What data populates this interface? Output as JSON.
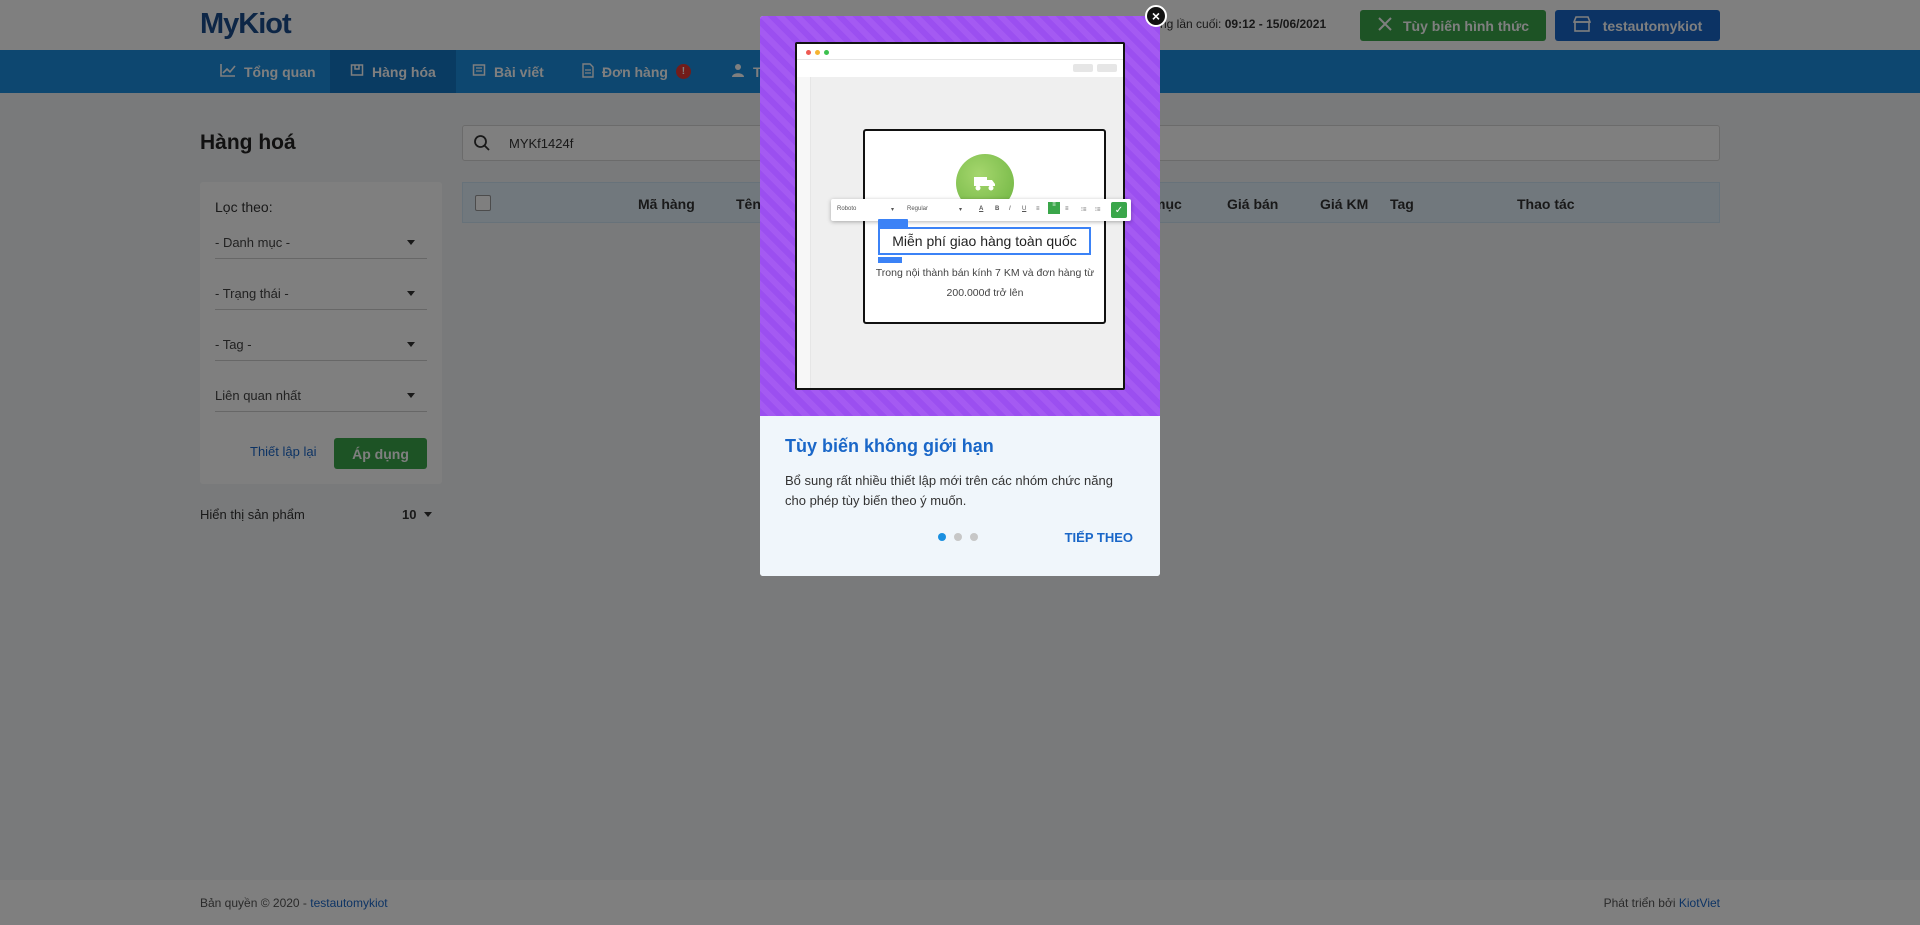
{
  "header": {
    "logo": "MyKiot",
    "last_login_prefix": "ng lần cuối:",
    "last_login_value": "09:12 - 15/06/2021",
    "customize_label": "Tùy biến hình thức",
    "store_label": "testautomykiot"
  },
  "nav": {
    "items": [
      {
        "label": "Tổng quan",
        "icon": "chart-line-icon"
      },
      {
        "label": "Hàng hóa",
        "icon": "box-icon"
      },
      {
        "label": "Bài viết",
        "icon": "newspaper-icon"
      },
      {
        "label": "Đơn hàng",
        "icon": "document-icon",
        "badge": "!"
      },
      {
        "label": "T",
        "icon": "user-icon"
      }
    ]
  },
  "main": {
    "title": "Hàng hoá",
    "search_value": "MYKf1424f",
    "filter": {
      "title": "Lọc theo:",
      "selects": [
        "- Danh mục -",
        "- Trạng thái -",
        "- Tag -",
        "Liên quan nhất"
      ],
      "reset_label": "Thiết lập lại",
      "apply_label": "Áp dụng"
    },
    "show_count_label": "Hiển thị sản phẩm",
    "show_count_value": "10",
    "table_headers": [
      "Mã hàng",
      "Tên",
      "mục",
      "Giá bán",
      "Giá KM",
      "Tag",
      "Thao tác"
    ]
  },
  "footer": {
    "copyright": "Bản quyền © 2020 - ",
    "copyright_link": "testautomykiot",
    "dev": "Phát triển bởi ",
    "dev_link": "KiotViet"
  },
  "modal": {
    "close": "×",
    "mock": {
      "font": "Roboto",
      "weight": "Regular",
      "heading": "Miễn phí giao hàng toàn quốc",
      "body": "Trong nội thành bán kính 7 KM và đơn hàng từ 200.000đ trở lên"
    },
    "title": "Tùy biến không giới hạn",
    "desc": "Bổ sung rất nhiều thiết lập mới trên các nhóm chức năng cho phép tùy biến theo ý muốn.",
    "next_label": "TIẾP THEO",
    "page_total": 3,
    "page_current": 1
  },
  "colors": {
    "primary": "#1a8fe0",
    "green": "#3aa64a",
    "modal_purple": "#9b4ff0",
    "link": "#1a67c8"
  }
}
